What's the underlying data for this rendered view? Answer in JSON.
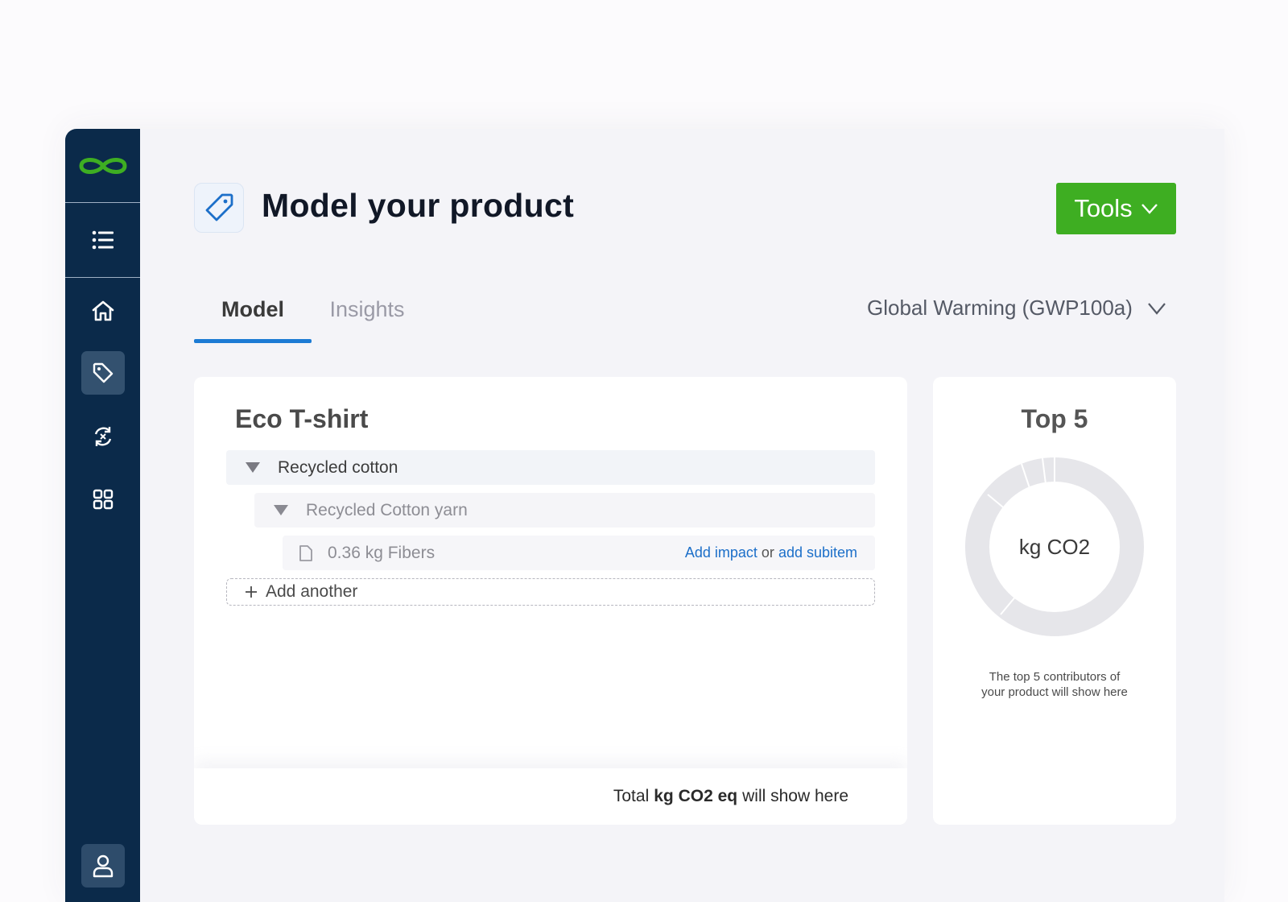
{
  "header": {
    "title": "Model your product",
    "tools_label": "Tools"
  },
  "tabs": [
    {
      "label": "Model",
      "active": true
    },
    {
      "label": "Insights",
      "active": false
    }
  ],
  "impact_method": {
    "selected": "Global Warming (GWP100a)"
  },
  "model": {
    "product_name": "Eco T-shirt",
    "items": [
      {
        "level": 0,
        "label": "Recycled cotton"
      },
      {
        "level": 1,
        "label": "Recycled Cotton yarn"
      },
      {
        "level": 2,
        "label": "0.36 kg Fibers",
        "actions": {
          "add_impact": "Add impact",
          "or": "or",
          "add_subitem": "add subitem"
        }
      }
    ],
    "add_another": "Add another",
    "footer": {
      "prefix": "Total",
      "unit": "kg CO2 eq",
      "suffix": "will show here"
    }
  },
  "top5": {
    "title": "Top 5",
    "center_label": "kg CO2",
    "caption_line1": "The top 5 contributors of",
    "caption_line2": "your product will show here"
  },
  "colors": {
    "sidebar": "#0b2a4a",
    "accent_green": "#3eae22",
    "accent_blue": "#1c7bd4",
    "link_blue": "#1c6fc9",
    "donut_grey": "#e6e6ea"
  },
  "icons": {
    "logo": "infinity-logo-icon",
    "menu": "list-icon",
    "home": "home-icon",
    "product": "tag-icon",
    "cycle": "recycle-icon",
    "apps": "grid-icon",
    "user": "user-icon"
  }
}
